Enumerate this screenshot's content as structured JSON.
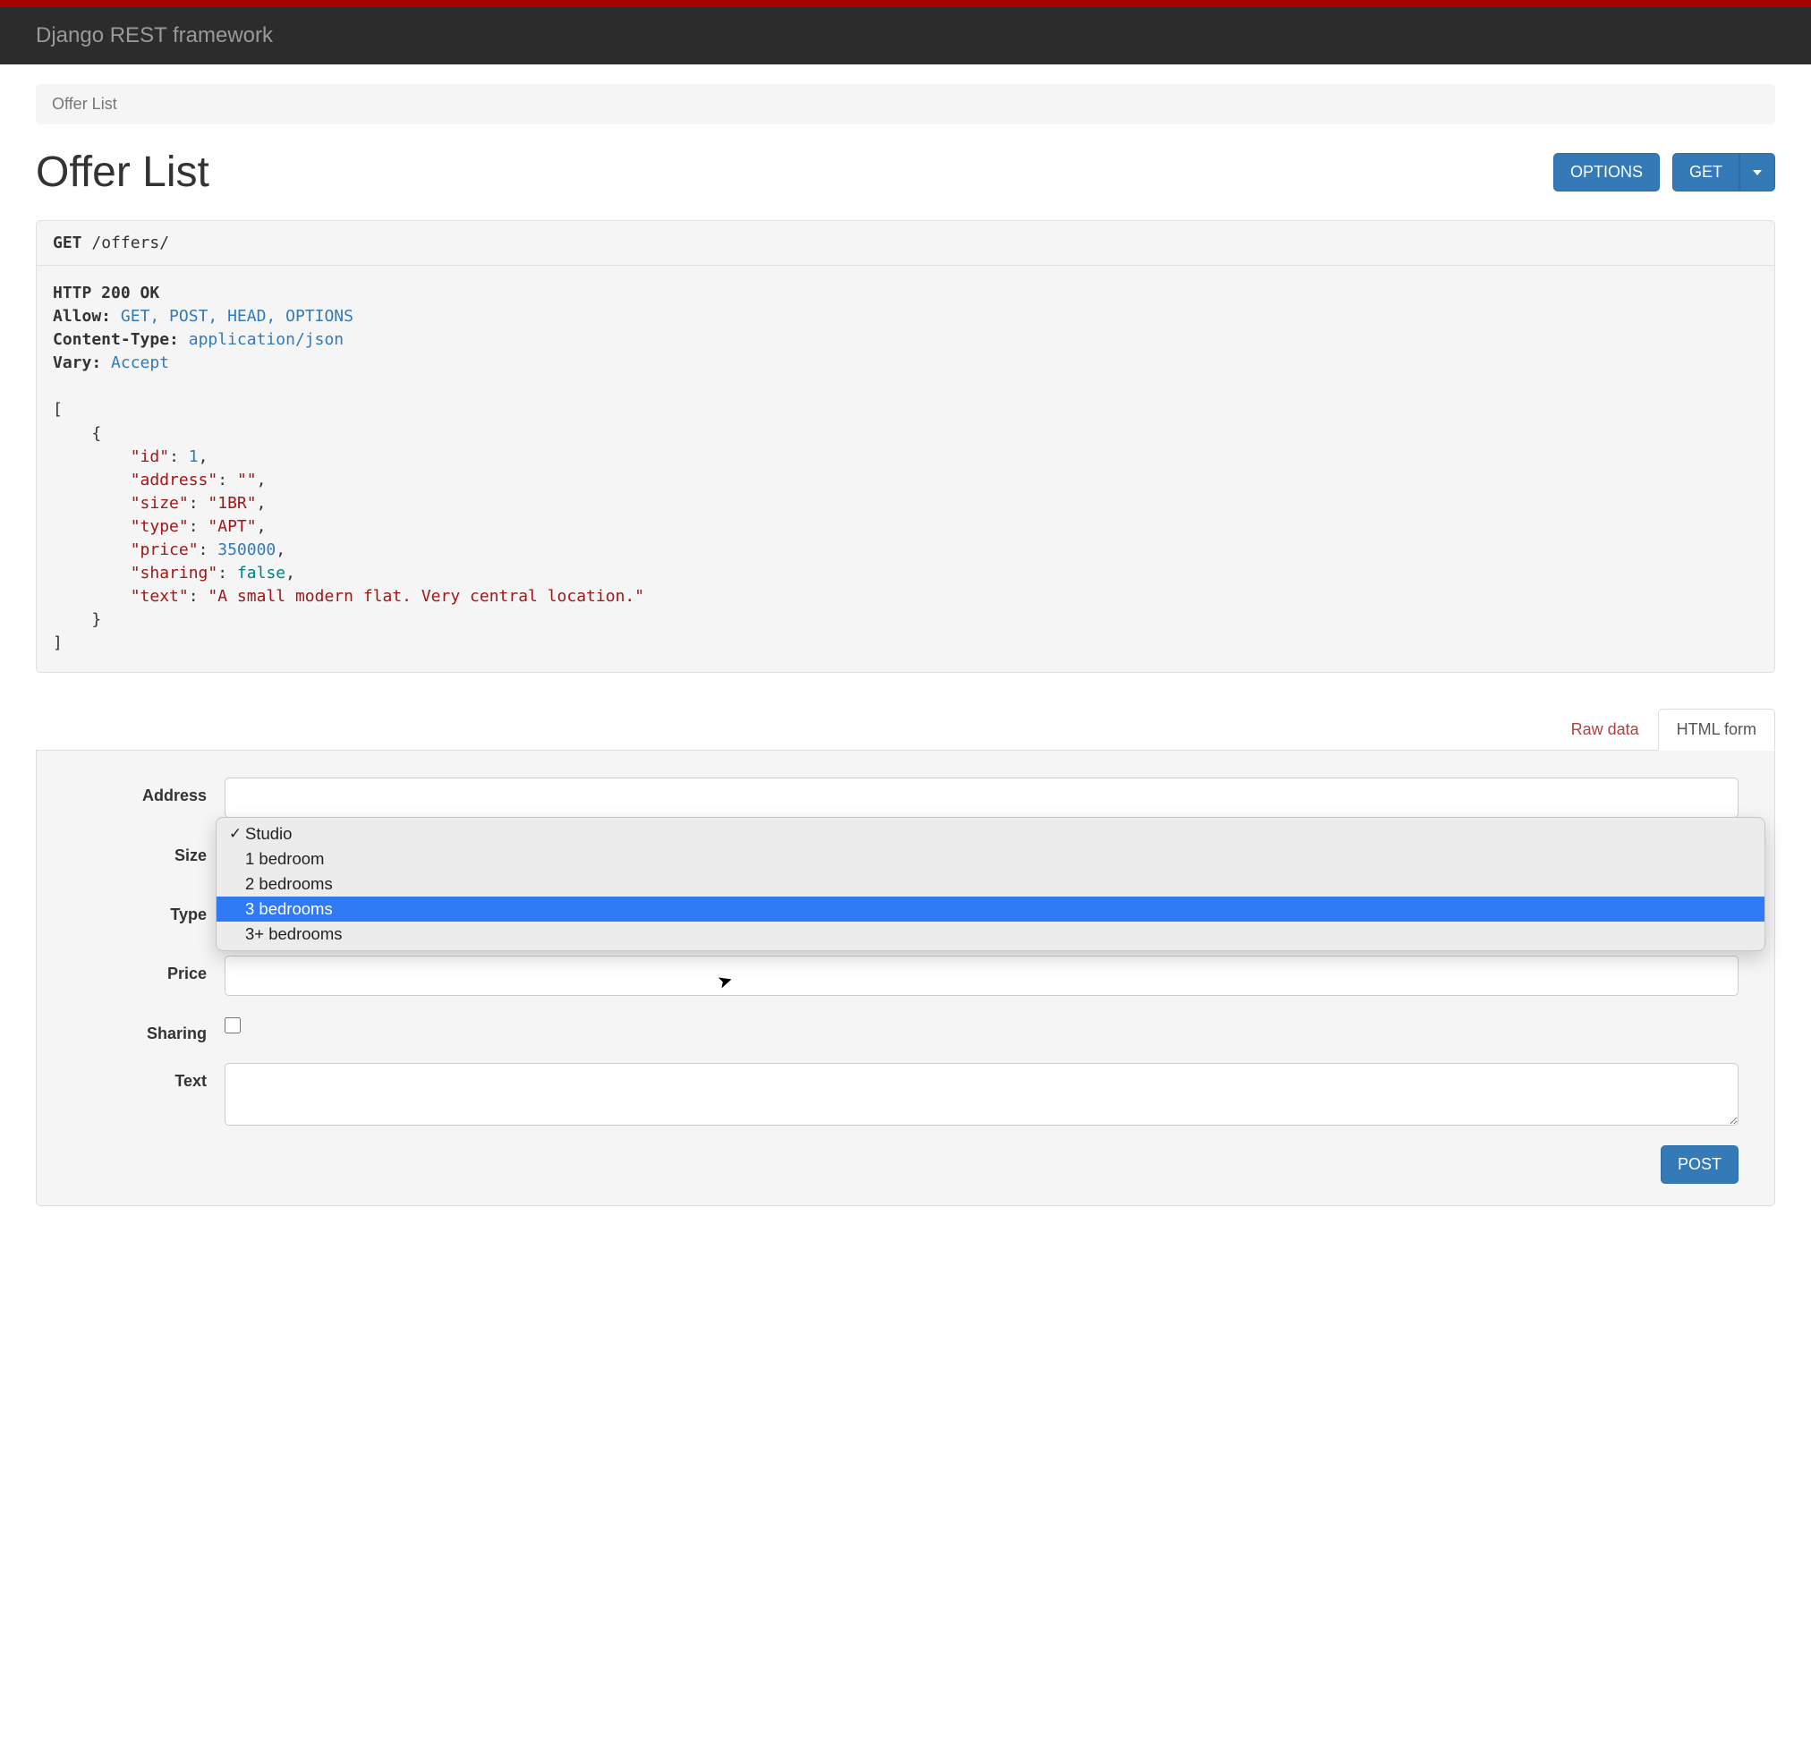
{
  "brand": "Django REST framework",
  "breadcrumb": "Offer List",
  "page_title": "Offer List",
  "buttons": {
    "options": "OPTIONS",
    "get": "GET",
    "post": "POST"
  },
  "request": {
    "method": "GET",
    "path": "/offers/"
  },
  "response": {
    "status_line": "HTTP 200 OK",
    "headers": {
      "allow_k": "Allow:",
      "allow_v": "GET, POST, HEAD, OPTIONS",
      "ctype_k": "Content-Type:",
      "ctype_v": "application/json",
      "vary_k": "Vary:",
      "vary_v": "Accept"
    },
    "body": {
      "id_k": "\"id\"",
      "id_v": "1",
      "address_k": "\"address\"",
      "address_v": "\"\"",
      "size_k": "\"size\"",
      "size_v": "\"1BR\"",
      "type_k": "\"type\"",
      "type_v": "\"APT\"",
      "price_k": "\"price\"",
      "price_v": "350000",
      "sharing_k": "\"sharing\"",
      "sharing_v": "false",
      "text_k": "\"text\"",
      "text_v": "\"A small modern flat. Very central location.\""
    }
  },
  "tabs": {
    "raw": "Raw data",
    "html": "HTML form"
  },
  "form": {
    "address_label": "Address",
    "size_label": "Size",
    "type_label": "Type",
    "price_label": "Price",
    "sharing_label": "Sharing",
    "text_label": "Text"
  },
  "dropdown": {
    "opt0": "Studio",
    "opt1": "1 bedroom",
    "opt2": "2 bedrooms",
    "opt3": "3 bedrooms",
    "opt4": "3+ bedrooms",
    "check": "✓"
  }
}
